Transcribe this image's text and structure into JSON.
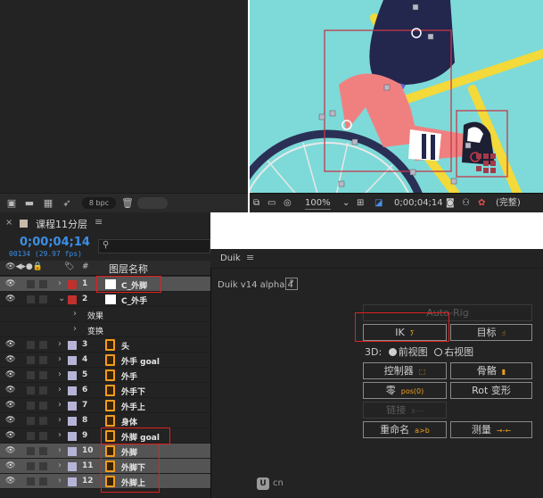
{
  "project_toolbar": {
    "bpc_label": "8 bpc"
  },
  "viewer_toolbar": {
    "zoom": "100%",
    "timecode": "0;00;04;14",
    "quality": "(完整)"
  },
  "timeline": {
    "comp_name": "课程11分层",
    "current_time": "0;00;04;14",
    "frame_info": "00134 (29.97 fps)",
    "search_placeholder": "",
    "header_number": "#",
    "header_layer_name": "图层名称",
    "rows": [
      {
        "num": "1",
        "name": "C_外脚",
        "kind": "solid",
        "color": "#c0302e",
        "expanded": false,
        "selected": true
      },
      {
        "num": "2",
        "name": "C_外手",
        "kind": "solid",
        "color": "#c0302e",
        "expanded": true,
        "selected": false
      },
      {
        "num": "",
        "name": "效果",
        "kind": "property"
      },
      {
        "num": "",
        "name": "变换",
        "kind": "property"
      },
      {
        "num": "3",
        "name": "头",
        "kind": "shape",
        "color": "#b6b4d6"
      },
      {
        "num": "4",
        "name": "外手 goal",
        "kind": "shape",
        "color": "#b6b4d6"
      },
      {
        "num": "5",
        "name": "外手",
        "kind": "shape",
        "color": "#b6b4d6"
      },
      {
        "num": "6",
        "name": "外手下",
        "kind": "shape",
        "color": "#b6b4d6"
      },
      {
        "num": "7",
        "name": "外手上",
        "kind": "shape",
        "color": "#b6b4d6"
      },
      {
        "num": "8",
        "name": "身体",
        "kind": "shape",
        "color": "#b6b4d6"
      },
      {
        "num": "9",
        "name": "外脚 goal",
        "kind": "shape",
        "color": "#b6b4d6"
      },
      {
        "num": "10",
        "name": "外脚",
        "kind": "shape",
        "color": "#b6b4d6",
        "selected": true
      },
      {
        "num": "11",
        "name": "外脚下",
        "kind": "shape",
        "color": "#b6b4d6",
        "selected": true
      },
      {
        "num": "12",
        "name": "外脚上",
        "kind": "shape",
        "color": "#b6b4d6",
        "selected": true
      }
    ]
  },
  "duik": {
    "tab_title": "Duik",
    "version": "Duik v14 alpha 4",
    "help_button": "?",
    "autorig_button": "Auto-Rig",
    "ik_button": "IK",
    "goal_button": "目标",
    "view_label": "3D:",
    "front_view": "前视图",
    "right_view": "右视图",
    "controller_button": "控制器",
    "bone_button": "骨骼",
    "zero_button": "零",
    "zero_icon_text": "pos(0)",
    "rot_morph_button": "Rot 变形",
    "link_button": "链接",
    "rename_button": "重命名",
    "rename_icon_text": "a>b",
    "measure_button": "测量",
    "watermark": "cn"
  },
  "colors": {
    "accent_blue": "#3b8fe6",
    "highlight_red": "#e02020",
    "icon_orange": "#f29b1e"
  }
}
